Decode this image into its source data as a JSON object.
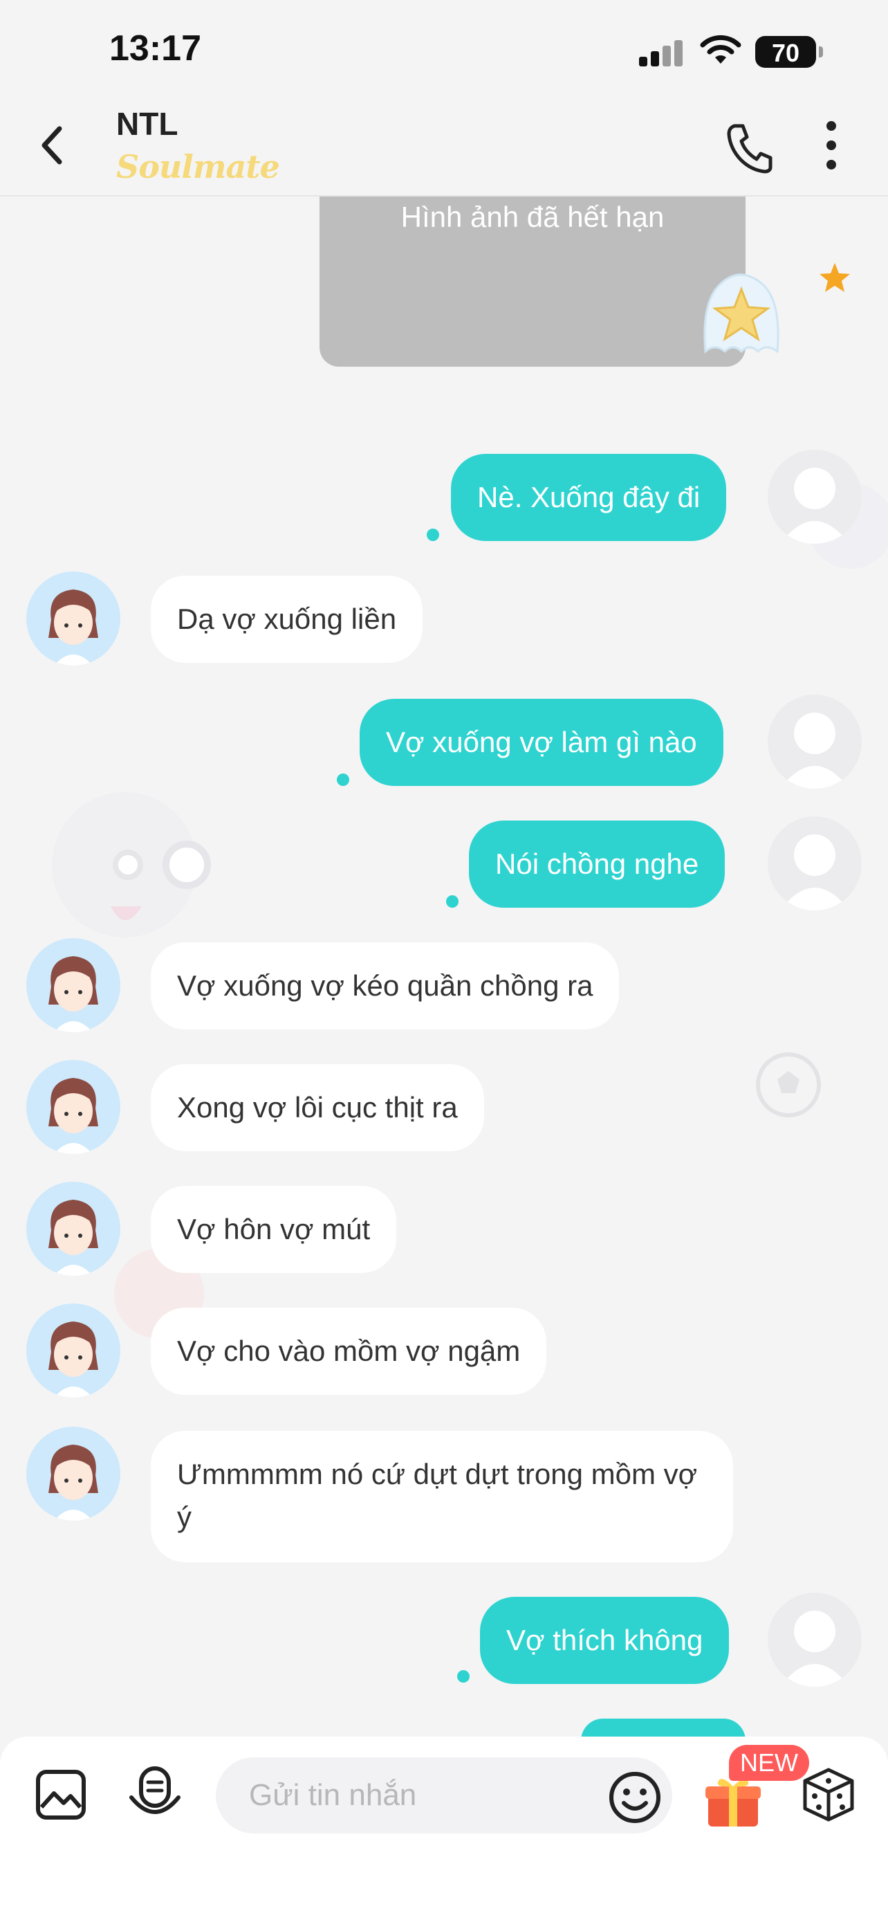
{
  "status": {
    "time": "13:17",
    "battery": "70",
    "battery_level": 0.7
  },
  "header": {
    "name": "NTL",
    "subtitle": "Soulmate"
  },
  "expired_image": {
    "text": "Hình ảnh đã hết hạn"
  },
  "messages": [
    {
      "dir": "out",
      "text": "Nè. Xuống đây đi"
    },
    {
      "dir": "in",
      "text": "Dạ vợ xuống liền"
    },
    {
      "dir": "out",
      "text": "Vợ xuống vợ làm gì nào"
    },
    {
      "dir": "out",
      "text": "Nói chồng nghe"
    },
    {
      "dir": "in",
      "text": "Vợ xuống vợ kéo quần chồng ra"
    },
    {
      "dir": "in",
      "text": "Xong vợ lôi cục thịt ra"
    },
    {
      "dir": "in",
      "text": "Vợ hôn vợ mút"
    },
    {
      "dir": "in",
      "text": "Vợ cho vào mồm vợ ngậm"
    },
    {
      "dir": "in",
      "text": "Ưmmmmm nó cứ dựt dựt trong mồm vợ ý"
    },
    {
      "dir": "out",
      "text": "Vợ thích không"
    }
  ],
  "composer": {
    "placeholder": "Gửi tin nhắn",
    "new_badge": "NEW"
  },
  "colors": {
    "accent": "#2ed3d0",
    "badge": "#ff5a5a",
    "star": "#f5a623"
  }
}
